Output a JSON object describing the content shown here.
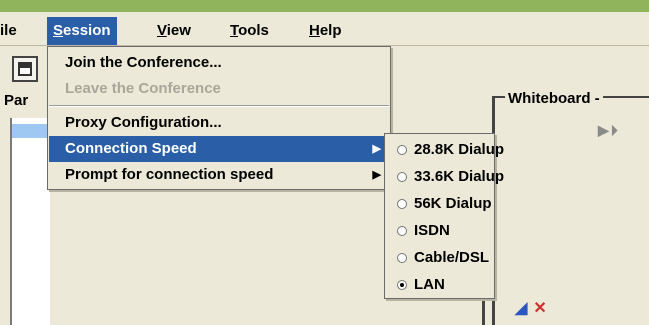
{
  "menubar": {
    "items": [
      {
        "label": "File",
        "mnemonic": "F",
        "visible_text": "ile"
      },
      {
        "label": "Session",
        "mnemonic": "S",
        "rest": "ession"
      },
      {
        "label": "View",
        "mnemonic": "V",
        "rest": "iew"
      },
      {
        "label": "Tools",
        "mnemonic": "T",
        "rest": "ools"
      },
      {
        "label": "Help",
        "mnemonic": "H",
        "rest": "elp"
      }
    ]
  },
  "left_panel": {
    "label": "Par"
  },
  "whiteboard": {
    "title": "Whiteboard -"
  },
  "session_menu": {
    "items": [
      {
        "label": "Join the Conference...",
        "enabled": true
      },
      {
        "label": "Leave the Conference",
        "enabled": false
      },
      {
        "label": "Proxy Configuration...",
        "enabled": true
      },
      {
        "label": "Connection Speed",
        "enabled": true,
        "submenu": true,
        "highlighted": true
      },
      {
        "label": "Prompt for connection speed",
        "enabled": true,
        "submenu": true
      }
    ]
  },
  "connection_speed_menu": {
    "options": [
      {
        "label": "28.8K Dialup",
        "selected": false
      },
      {
        "label": "33.6K Dialup",
        "selected": false
      },
      {
        "label": "56K Dialup",
        "selected": false
      },
      {
        "label": "ISDN",
        "selected": false
      },
      {
        "label": "Cable/DSL",
        "selected": false
      },
      {
        "label": "LAN",
        "selected": true
      }
    ]
  },
  "colors": {
    "menu_highlight": "#2a5fa8",
    "title_bar": "#8fb45c",
    "panel_bg": "#ECE9D8"
  }
}
